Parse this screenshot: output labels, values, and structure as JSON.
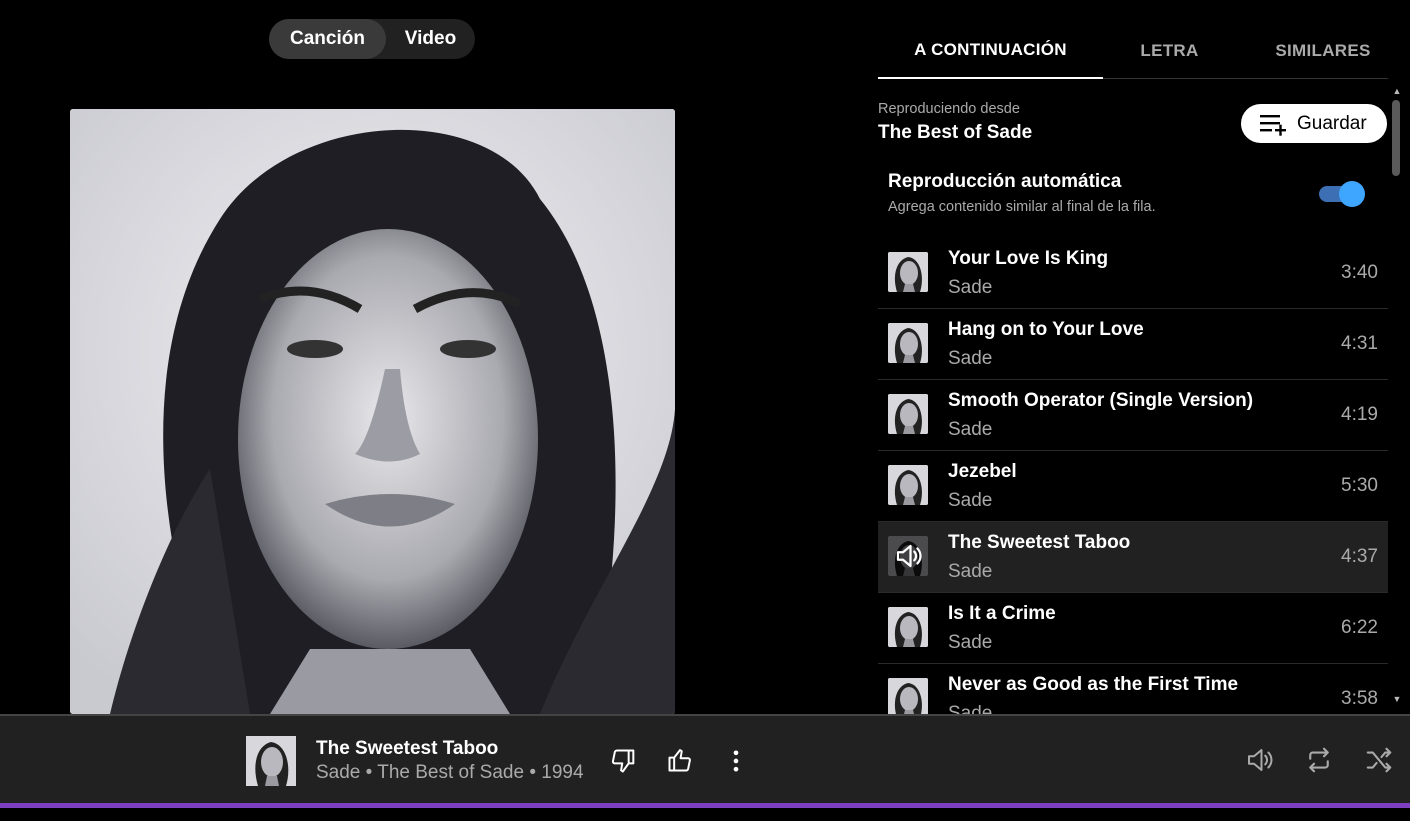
{
  "mode_toggle": {
    "song_label": "Canción",
    "video_label": "Video"
  },
  "tabs": [
    {
      "label": "A CONTINUACIÓN",
      "active": true
    },
    {
      "label": "LETRA",
      "active": false
    },
    {
      "label": "SIMILARES",
      "active": false
    }
  ],
  "queue_header": {
    "playing_from_label": "Reproduciendo desde",
    "playlist_name": "The Best of Sade",
    "save_label": "Guardar"
  },
  "autoplay": {
    "title": "Reproducción automática",
    "subtitle": "Agrega contenido similar al final de la fila.",
    "enabled": true
  },
  "queue": [
    {
      "title": "Your Love Is King",
      "artist": "Sade",
      "duration": "3:40",
      "playing": false
    },
    {
      "title": "Hang on to Your Love",
      "artist": "Sade",
      "duration": "4:31",
      "playing": false
    },
    {
      "title": "Smooth Operator (Single Version)",
      "artist": "Sade",
      "duration": "4:19",
      "playing": false
    },
    {
      "title": "Jezebel",
      "artist": "Sade",
      "duration": "5:30",
      "playing": false
    },
    {
      "title": "The Sweetest Taboo",
      "artist": "Sade",
      "duration": "4:37",
      "playing": true
    },
    {
      "title": "Is It a Crime",
      "artist": "Sade",
      "duration": "6:22",
      "playing": false
    },
    {
      "title": "Never as Good as the First Time",
      "artist": "Sade",
      "duration": "3:58",
      "playing": false
    }
  ],
  "now_playing": {
    "title": "The Sweetest Taboo",
    "meta": "Sade • The Best of Sade • 1994"
  },
  "colors": {
    "accent": "#3ea6ff",
    "progress": "#7b3fbf",
    "bar": "#212121"
  },
  "icons": [
    "thumbs-down-icon",
    "thumbs-up-icon",
    "more-vert-icon",
    "volume-icon",
    "repeat-icon",
    "shuffle-icon",
    "playlist-add-icon",
    "speaker-icon"
  ]
}
